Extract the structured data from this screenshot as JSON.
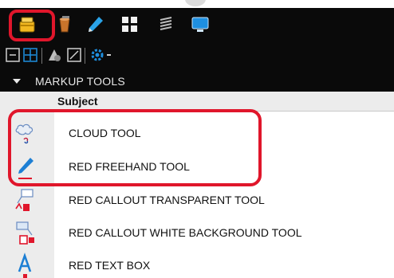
{
  "panel": {
    "section_title": "MARKUP TOOLS",
    "column_header": "Subject"
  },
  "toolbar": {
    "icons": [
      "tool-chest-icon",
      "bucket-icon",
      "pen-icon",
      "grid-icon",
      "layers-icon",
      "monitor-icon"
    ],
    "sub_icons": [
      "collapse-icon",
      "expand-icon",
      "properties-icon",
      "edit-icon",
      "gear-icon",
      "dropdown-icon"
    ]
  },
  "tools": [
    {
      "label": "CLOUD TOOL",
      "icon": "cloud-icon"
    },
    {
      "label": "RED FREEHAND TOOL",
      "icon": "freehand-pen-icon"
    },
    {
      "label": "RED CALLOUT TRANSPARENT TOOL",
      "icon": "callout-transparent-icon"
    },
    {
      "label": "RED CALLOUT WHITE BACKGROUND TOOL",
      "icon": "callout-white-icon"
    },
    {
      "label": "RED TEXT BOX",
      "icon": "text-box-icon"
    }
  ],
  "colors": {
    "dark_bar": "#0a0a0a",
    "highlight": "#e0162b",
    "accent_blue": "#1e8fe0"
  }
}
